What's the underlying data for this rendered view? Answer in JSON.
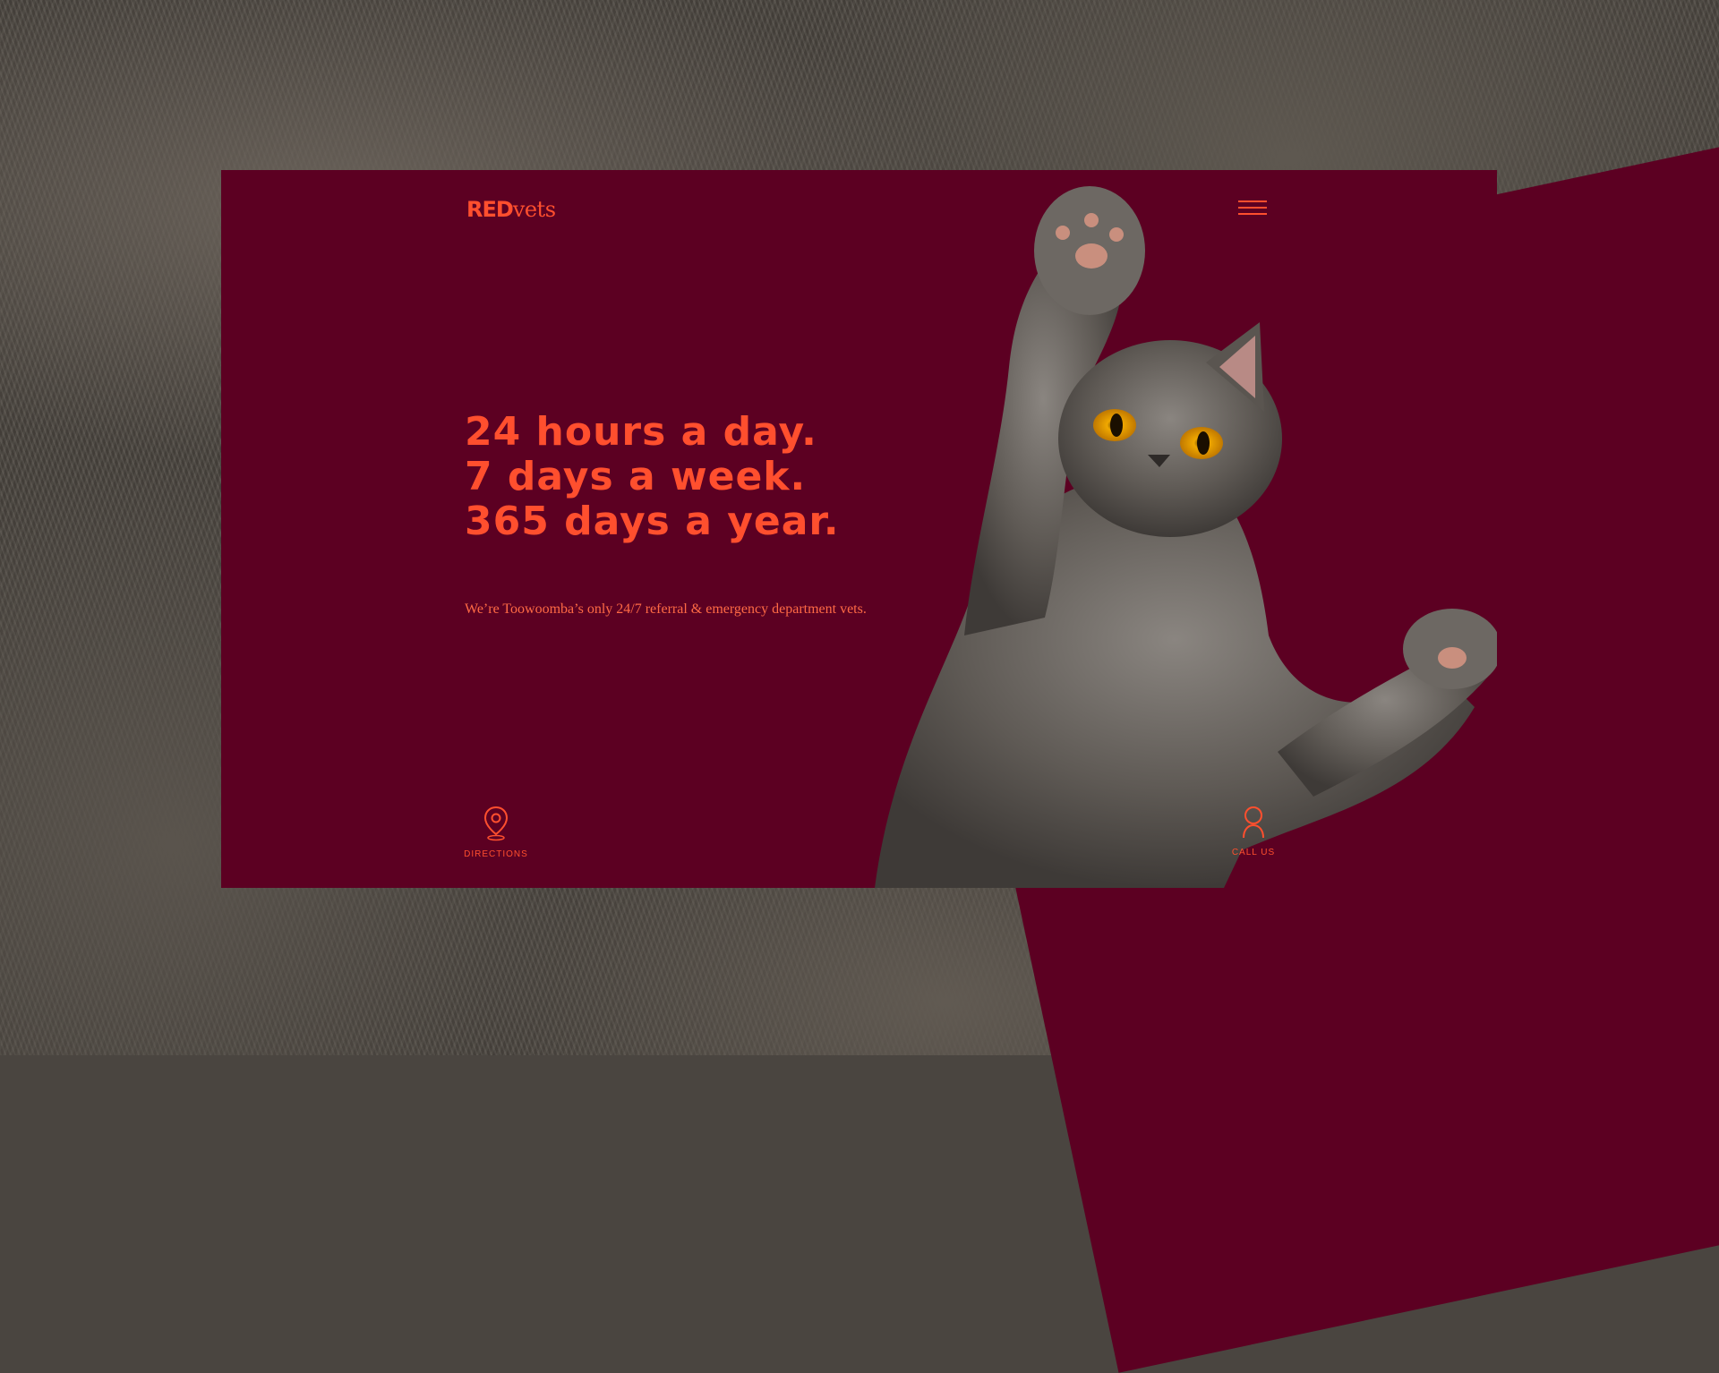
{
  "brand": {
    "logo_bold": "RED",
    "logo_light": "vets"
  },
  "hero": {
    "lines": [
      "24 hours a day.",
      "7 days a week.",
      "365 days a year."
    ],
    "subtitle": "We’re Toowoomba’s only 24/7 referral & emergency department vets."
  },
  "actions": {
    "directions_label": "DIRECTIONS",
    "call_label": "CALL US"
  },
  "icons": {
    "menu": "hamburger-icon",
    "directions": "map-pin-icon",
    "call": "person-icon"
  },
  "colors": {
    "accent": "#ff4f2e",
    "card_bg": "#5c0022",
    "fur": "#4b4640"
  }
}
